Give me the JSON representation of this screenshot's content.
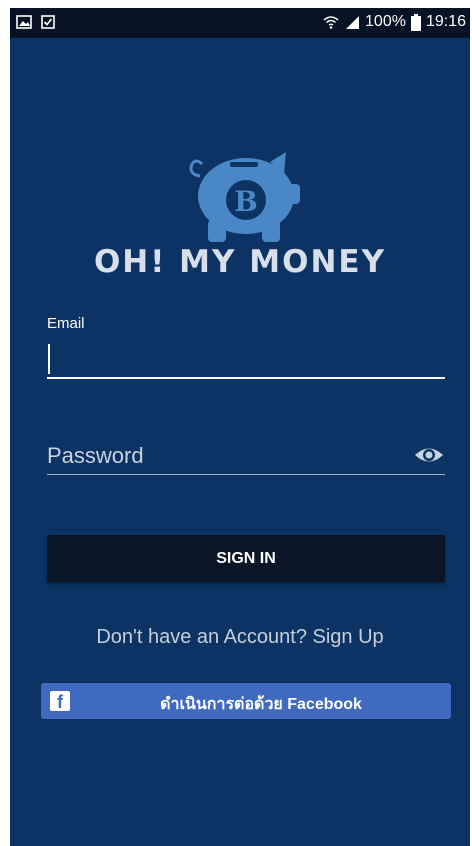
{
  "status_bar": {
    "battery": "100%",
    "time": "19:16"
  },
  "app": {
    "name": "OH! MY MONEY",
    "logo_symbol": "B"
  },
  "login": {
    "email_label": "Email",
    "email_value": "",
    "password_placeholder": "Password",
    "sign_in_label": "SIGN IN",
    "signup_text": "Don't have an Account? Sign Up",
    "facebook_label": "ดำเนินการต่อด้วย Facebook",
    "facebook_icon": "f"
  },
  "colors": {
    "background": "#0c3363",
    "status_bar": "#071224",
    "logo": "#4a87c6",
    "sign_in_button": "#0a1628",
    "facebook_button": "#3f6abf"
  },
  "icons": [
    "gallery-icon",
    "checkbox-icon",
    "wifi-icon",
    "signal-icon",
    "battery-icon",
    "piggy-bank-logo",
    "eye-icon",
    "facebook-icon"
  ]
}
